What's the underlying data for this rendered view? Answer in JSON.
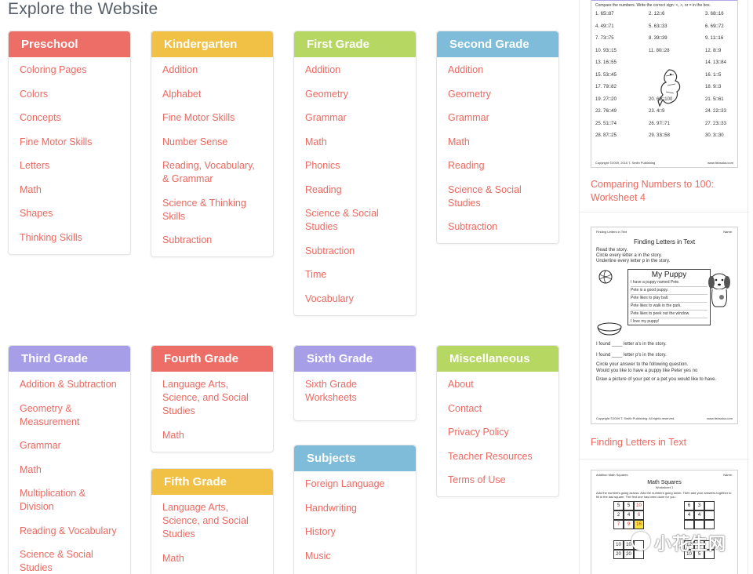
{
  "page": {
    "title": "Explore the Website"
  },
  "cards": {
    "preschool": {
      "title": "Preschool",
      "items": [
        "Coloring Pages",
        "Colors",
        "Concepts",
        "Fine Motor Skills",
        "Letters",
        "Math",
        "Shapes",
        "Thinking Skills"
      ]
    },
    "kindergarten": {
      "title": "Kindergarten",
      "items": [
        "Addition",
        "Alphabet",
        "Fine Motor Skills",
        "Number Sense",
        "Reading, Vocabulary, & Grammar",
        "Science & Thinking Skills",
        "Subtraction"
      ]
    },
    "first": {
      "title": "First Grade",
      "items": [
        "Addition",
        "Geometry",
        "Grammar",
        "Math",
        "Phonics",
        "Reading",
        "Science & Social Studies",
        "Subtraction",
        "Time",
        "Vocabulary"
      ]
    },
    "second": {
      "title": "Second Grade",
      "items": [
        "Addition",
        "Geometry",
        "Grammar",
        "Math",
        "Reading",
        "Science & Social Studies",
        "Subtraction"
      ]
    },
    "third": {
      "title": "Third Grade",
      "items": [
        "Addition & Subtraction",
        "Geometry & Measurement",
        "Grammar",
        "Math",
        "Multiplication & Division",
        "Reading & Vocabulary",
        "Science & Social Studies"
      ]
    },
    "fourth": {
      "title": "Fourth Grade",
      "items": [
        "Language Arts, Science, and Social Studies",
        "Math"
      ]
    },
    "fifth": {
      "title": "Fifth Grade",
      "items": [
        "Language Arts, Science, and Social Studies",
        "Math"
      ]
    },
    "sixth": {
      "title": "Sixth Grade",
      "items": [
        "Sixth Grade Worksheets"
      ]
    },
    "subjects": {
      "title": "Subjects",
      "items": [
        "Foreign Language",
        "Handwriting",
        "History",
        "Music"
      ]
    },
    "misc": {
      "title": "Miscellaneous",
      "items": [
        "About",
        "Contact",
        "Privacy Policy",
        "Teacher Resources",
        "Terms of Use"
      ]
    }
  },
  "sidebar": {
    "ws1": {
      "caption": "Comparing Numbers to 100: Worksheet 4",
      "instruction": "Compare the numbers. Write the correct sign: <, >, or = in the box.",
      "rows": [
        [
          "1. 65□87",
          "2. 12□6",
          "3. 68□16"
        ],
        [
          "4. 49□71",
          "5. 63□33",
          "6. 69□72"
        ],
        [
          "7. 73□75",
          "8. 39□39",
          "9. 11□16"
        ],
        [
          "10. 93□15",
          "11. 80□28",
          "12. 8□9"
        ],
        [
          "13. 16□55",
          "",
          "14. 13□84"
        ],
        [
          "15. 53□45",
          "",
          "16. 1□5"
        ],
        [
          "17. 79□82",
          "",
          "18. 9□3"
        ],
        [
          "19. 27□20",
          "20. 69□100",
          "21. 5□61"
        ],
        [
          "22. 76□49",
          "23. 4□9",
          "24. 22□33"
        ],
        [
          "25. 51□74",
          "26. 97□71",
          "27. 23□33"
        ],
        [
          "28. 87□25",
          "29. 33□58",
          "30. 3□30"
        ]
      ],
      "footer_left": "Copyright ©2009, 2010 T. Smith Publishing",
      "footer_right": "www.fishsoka.com"
    },
    "ws2": {
      "caption": "Finding Letters in Text",
      "header_left": "Finding Letters in Text",
      "header_right": "Name:",
      "title": "Finding Letters in Text",
      "instructions": [
        "Read the story.",
        "Circle every letter a in the story.",
        "Underline every letter p in the story."
      ],
      "story_title": "My Puppy",
      "story_lines": [
        "I have a puppy named Pete.",
        "Pete is a good puppy.",
        "Pete likes to play ball.",
        "Pete likes to walk in the park.",
        "Pete likes to peek out the window.",
        "I love my puppy!"
      ],
      "q1": "I found ____ letter a's in the story.",
      "q2": "I found ____ letter p's in the story.",
      "q3": "Circle your answer to the following question.",
      "q4": "Would you like to have a puppy like Peter    yes    no",
      "q5": "Draw a picture of your pet or a pet you would like to have.",
      "footer_left": "Copyright ©2009 T. Smith Publishing. All rights reserved.",
      "footer_right": "www.fishsoka.com"
    },
    "ws3": {
      "header_left": "Addition Math Squares",
      "header_right": "Name:",
      "title": "Math Squares",
      "subtitle": "Worksheet 1",
      "instruction": "Add the numbers going across. Add the numbers going down. Then add your answers together to fill in the last square. The first one has been done for you.",
      "grid_a": [
        [
          "5",
          "5",
          "10"
        ],
        [
          "2",
          "4",
          "6"
        ],
        [
          "7",
          "9",
          "16"
        ]
      ],
      "grid_b": [
        [
          "6",
          "3",
          ""
        ],
        [
          "4",
          "4",
          ""
        ],
        [
          "",
          "",
          ""
        ]
      ],
      "grid_c": [
        [
          "10",
          "10",
          ""
        ],
        [
          "20",
          "20",
          ""
        ]
      ],
      "grid_d": [
        [
          "12",
          "15",
          ""
        ],
        [
          "10",
          "5",
          ""
        ]
      ]
    }
  },
  "watermark": {
    "text": "小花生网"
  },
  "colors": {
    "red": "#ec6e66",
    "yellow": "#f0c145",
    "green": "#b6d762",
    "blue": "#7ebcd9",
    "purple": "#a79ee8",
    "link": "#ea6a62"
  }
}
